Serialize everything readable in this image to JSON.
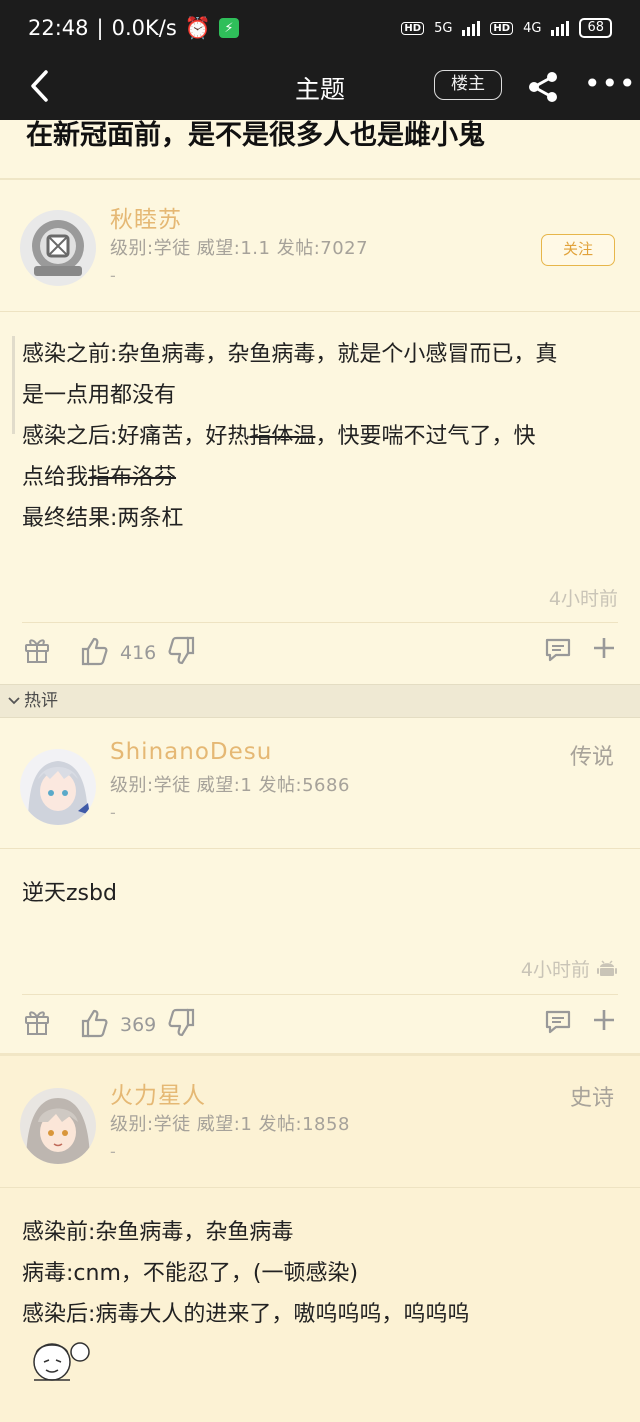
{
  "status": {
    "time": "22:48",
    "net_speed": "0.0K/s",
    "net1": "5G",
    "net2": "4G",
    "battery": "68"
  },
  "nav": {
    "back": "‹",
    "title": "主题",
    "op_label": "楼主"
  },
  "thread": {
    "title": "在新冠面前，是不是很多人也是雌小鬼"
  },
  "op_post": {
    "author": "秋睦苏",
    "meta": "级别:学徒 威望:1.1 发帖:7027",
    "dash": "-",
    "follow": "关注",
    "line1a": "感染之前:杂鱼病毒，杂鱼病毒，就是个小感冒而已，真",
    "line1b": "是一点用都没有",
    "line2a": "感染之后:好痛苦，好热",
    "line2strike": "指体温",
    "line2b": "，快要喘不过气了，快",
    "line3a": "点给我",
    "line3strike": "指布洛芬",
    "line4": "最终结果:两条杠",
    "time": "4小时前",
    "likes": "416"
  },
  "hot_label": "热评",
  "reply1": {
    "author": "ShinanoDesu",
    "meta": "级别:学徒 威望:1 发帖:5686",
    "dash": "-",
    "rank": "传说",
    "text": "逆天zsbd",
    "time": "4小时前",
    "likes": "369"
  },
  "reply2": {
    "author": "火力星人",
    "meta": "级别:学徒 威望:1 发帖:1858",
    "dash": "-",
    "rank": "史诗",
    "line1": "感染前:杂鱼病毒，杂鱼病毒",
    "line2": "病毒:cnm，不能忍了，(一顿感染)",
    "line3": "感染后:病毒大人的进来了，嗷呜呜呜，呜呜呜"
  },
  "colors": {
    "accent": "#e5b874",
    "background": "#fdf7df",
    "bar": "#1c1c1c"
  }
}
